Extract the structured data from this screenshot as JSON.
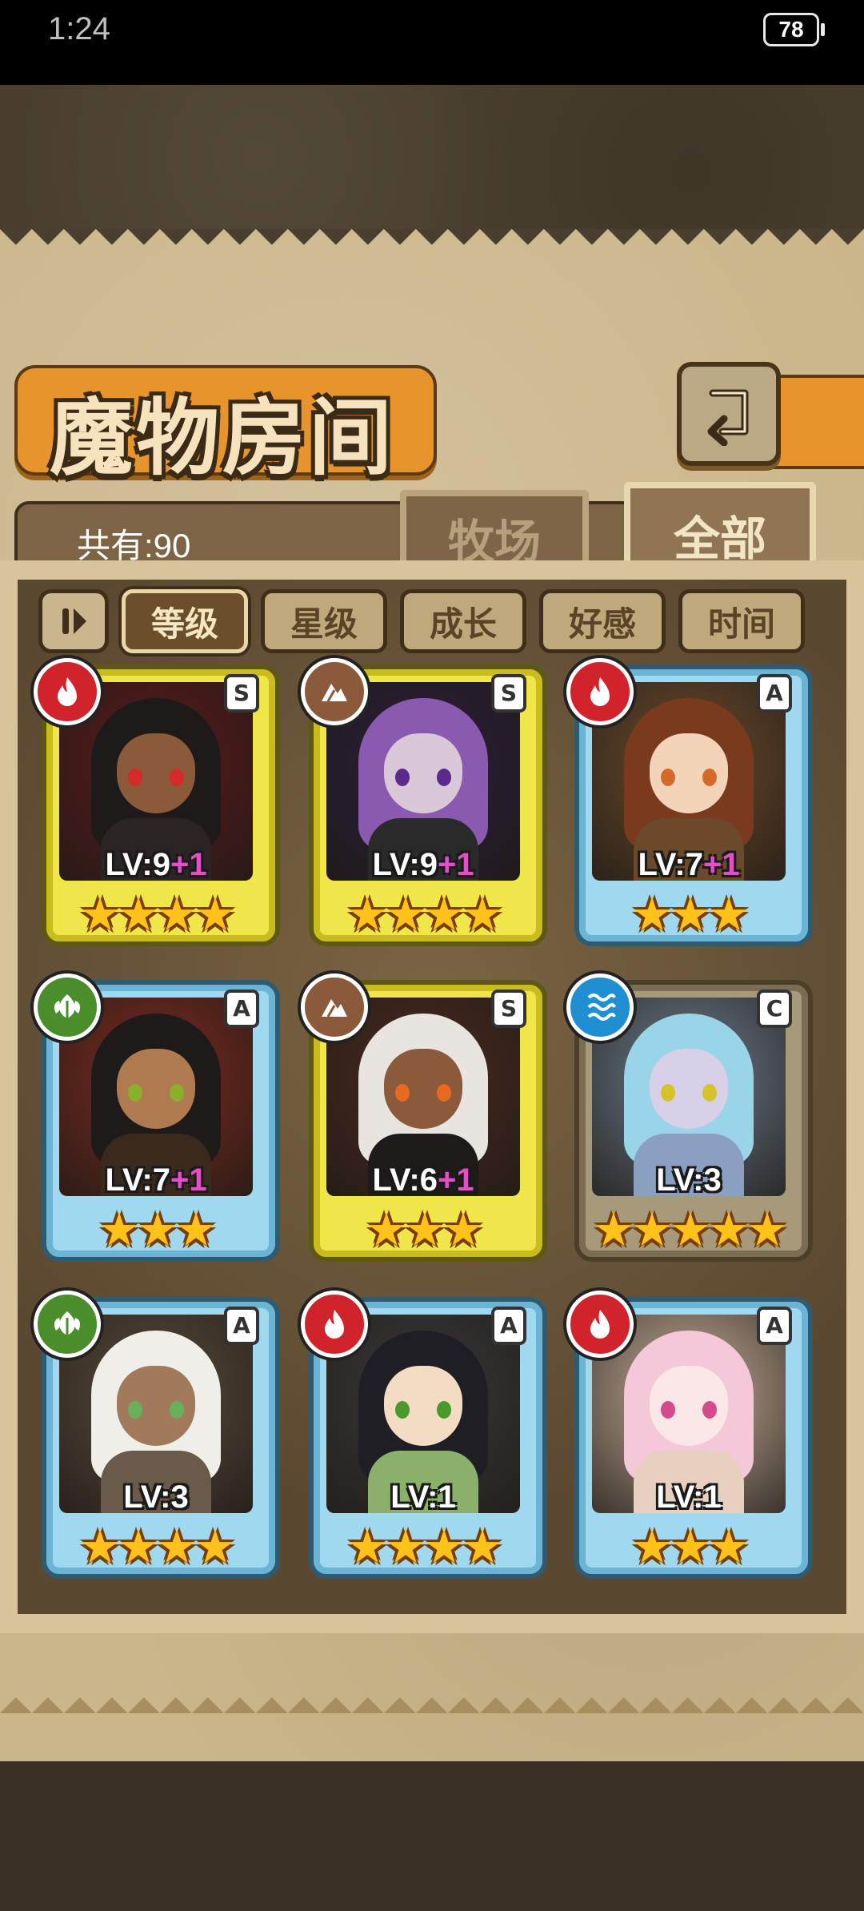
{
  "status_bar": {
    "time": "1:24",
    "battery": "78"
  },
  "header": {
    "title": "魔物房间",
    "back_icon": "return-arrow-icon"
  },
  "count_label": "共有:90",
  "tabs": [
    {
      "label": "牧场",
      "active": false
    },
    {
      "label": "全部",
      "active": true
    }
  ],
  "sort": {
    "toggle_icon": "sort-toggle-icon",
    "options": [
      {
        "label": "等级",
        "active": true
      },
      {
        "label": "星级",
        "active": false
      },
      {
        "label": "成长",
        "active": false
      },
      {
        "label": "好感",
        "active": false
      },
      {
        "label": "时间",
        "active": false
      }
    ]
  },
  "monsters": [
    {
      "rank": "S",
      "element": "fire",
      "lv": "LV:9",
      "bonus": "+1",
      "stars": 4
    },
    {
      "rank": "S",
      "element": "earth",
      "lv": "LV:9",
      "bonus": "+1",
      "stars": 4
    },
    {
      "rank": "A",
      "element": "fire",
      "lv": "LV:7",
      "bonus": "+1",
      "stars": 3
    },
    {
      "rank": "A",
      "element": "grass",
      "lv": "LV:7",
      "bonus": "+1",
      "stars": 3
    },
    {
      "rank": "S",
      "element": "earth",
      "lv": "LV:6",
      "bonus": "+1",
      "stars": 3
    },
    {
      "rank": "C",
      "element": "water",
      "lv": "LV:3",
      "bonus": "",
      "stars": 5
    },
    {
      "rank": "A",
      "element": "grass",
      "lv": "LV:3",
      "bonus": "",
      "stars": 4
    },
    {
      "rank": "A",
      "element": "fire",
      "lv": "LV:1",
      "bonus": "",
      "stars": 4
    },
    {
      "rank": "A",
      "element": "fire",
      "lv": "LV:1",
      "bonus": "",
      "stars": 3
    }
  ],
  "colors": {
    "accent_orange": "#e7942d",
    "panel_tan": "#cbb68a",
    "bonus_pink": "#e44ec7",
    "star_gold": "#ffc21a"
  }
}
